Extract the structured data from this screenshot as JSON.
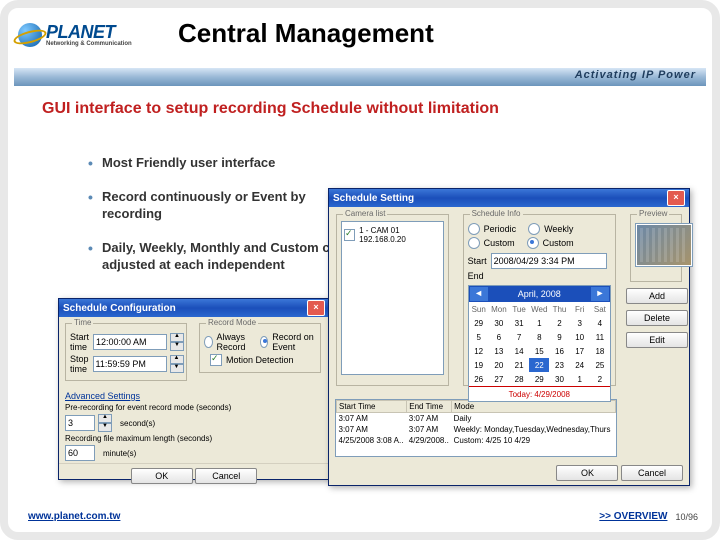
{
  "brand": {
    "name": "PLANET",
    "tagline": "Networking & Communication",
    "bar": "Activating IP Power"
  },
  "slide": {
    "title": "Central Management",
    "subtitle": "GUI interface to setup recording Schedule without limitation"
  },
  "bullets": [
    "Most Friendly user interface",
    "Record continuously or Event by recording",
    "Daily, Weekly, Monthly and Custom can be adjusted at each independent"
  ],
  "win1": {
    "title": "Schedule Configuration",
    "time_grp": "Time",
    "start_lbl": "Start time",
    "start_val": "12:00:00 AM",
    "stop_lbl": "Stop time",
    "stop_val": "11:59:59 PM",
    "mode_grp": "Record Mode",
    "mode_always": "Always Record",
    "mode_event": "Record on Event",
    "motion": "Motion Detection",
    "advanced": "Advanced Settings",
    "prerec_lbl": "Pre-recording for event record mode (seconds)",
    "prerec_val": "3",
    "maxlen_lbl": "Recording file maximum length (seconds)",
    "maxlen_val": "60",
    "ok": "OK",
    "cancel": "Cancel"
  },
  "win2": {
    "title": "Schedule Setting",
    "cam_grp": "Camera list",
    "cam_item": "1 - CAM 01 192.168.0.20",
    "sched_grp": "Schedule Info",
    "period": "Periodic",
    "week": "Weekly",
    "custom": "Custom",
    "start_lbl": "Start",
    "start_val": "2008/04/29 3:34 PM",
    "end_lbl": "End",
    "month": "April, 2008",
    "dow": [
      "Sun",
      "Mon",
      "Tue",
      "Wed",
      "Thu",
      "Fri",
      "Sat"
    ],
    "weeks": [
      [
        "29",
        "30",
        "31",
        "1",
        "2",
        "3",
        "4"
      ],
      [
        "5",
        "6",
        "7",
        "8",
        "9",
        "10",
        "11"
      ],
      [
        "12",
        "13",
        "14",
        "15",
        "16",
        "17",
        "18"
      ],
      [
        "19",
        "20",
        "21",
        "22",
        "23",
        "24",
        "25"
      ],
      [
        "26",
        "27",
        "28",
        "29",
        "30",
        "1",
        "2"
      ]
    ],
    "selected": "22",
    "today": "Today: 4/29/2008",
    "cols": {
      "c1": "Start Time",
      "c2": "End Time",
      "c3": "Mode"
    },
    "rows": [
      {
        "s": "3:07 AM",
        "e": "3:07 AM",
        "m": "Daily"
      },
      {
        "s": "3:07 AM",
        "e": "3:07 AM",
        "m": "Weekly: Monday,Tuesday,Wednesday,Thurs"
      },
      {
        "s": "4/25/2008 3:08 A..",
        "e": "4/29/2008..",
        "m": "Custom: 4/25 10 4/29"
      }
    ],
    "preview": "Preview",
    "add": "Add",
    "delete": "Delete",
    "edit": "Edit",
    "ok": "OK",
    "cancel": "Cancel"
  },
  "footer": {
    "url": "www.planet.com.tw",
    "overview": ">> OVERVIEW",
    "page": "10/96"
  }
}
